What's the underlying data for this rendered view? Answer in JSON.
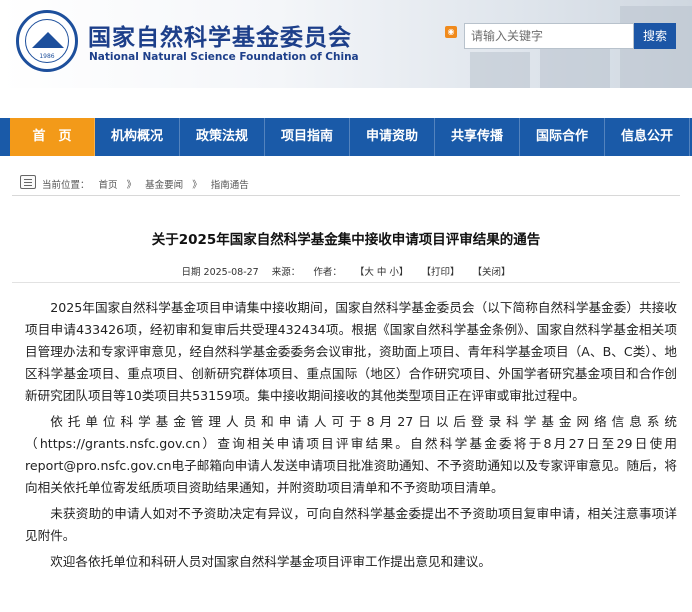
{
  "header": {
    "logo": {
      "year": "1986"
    },
    "cn_title": "国家自然科学基金委员会",
    "en_title": "National Natural Science Foundation of China",
    "search": {
      "placeholder": "请输入关键字",
      "button_label": "搜索"
    }
  },
  "nav": {
    "items": [
      {
        "label": "首　页",
        "active": true
      },
      {
        "label": "机构概况"
      },
      {
        "label": "政策法规"
      },
      {
        "label": "项目指南"
      },
      {
        "label": "申请资助"
      },
      {
        "label": "共享传播"
      },
      {
        "label": "国际合作"
      },
      {
        "label": "信息公开"
      }
    ]
  },
  "breadcrumb": {
    "prefix": "当前位置：",
    "items": [
      "首页",
      "》",
      "基金要闻",
      "》",
      "指南通告"
    ]
  },
  "article": {
    "title": "关于2025年国家自然科学基金集中接收申请项目评审结果的通告",
    "meta": {
      "date": "日期 2025-08-27",
      "source": "来源：",
      "author": "作者：",
      "font_size": "【大 中 小】",
      "print": "【打印】",
      "close": "【关闭】"
    },
    "paragraphs": [
      "2025年国家自然科学基金项目申请集中接收期间，国家自然科学基金委员会（以下简称自然科学基金委）共接收项目申请433426项，经初审和复审后共受理432434项。根据《国家自然科学基金条例》、国家自然科学基金相关项目管理办法和专家评审意见，经自然科学基金委委务会议审批，资助面上项目、青年科学基金项目（A、B、C类）、地区科学基金项目、重点项目、创新研究群体项目、重点国际（地区）合作研究项目、外国学者研究基金项目和合作创新研究团队项目等10类项目共53159项。集中接收期间接收的其他类型项目正在评审或审批过程中。",
      "依托单位科学基金管理人员和申请人可于8月27日以后登录科学基金网络信息系统（https://grants.nsfc.gov.cn）查询相关申请项目评审结果。自然科学基金委将于8月27日至29日使用report@pro.nsfc.gov.cn电子邮箱向申请人发送申请项目批准资助通知、不予资助通知以及专家评审意见。随后，将向相关依托单位寄发纸质项目资助结果通知，并附资助项目清单和不予资助项目清单。",
      "未获资助的申请人如对不予资助决定有异议，可向自然科学基金委提出不予资助项目复审申请，相关注意事项详见附件。",
      "欢迎各依托单位和科研人员对国家自然科学基金项目评审工作提出意见和建议。"
    ]
  }
}
